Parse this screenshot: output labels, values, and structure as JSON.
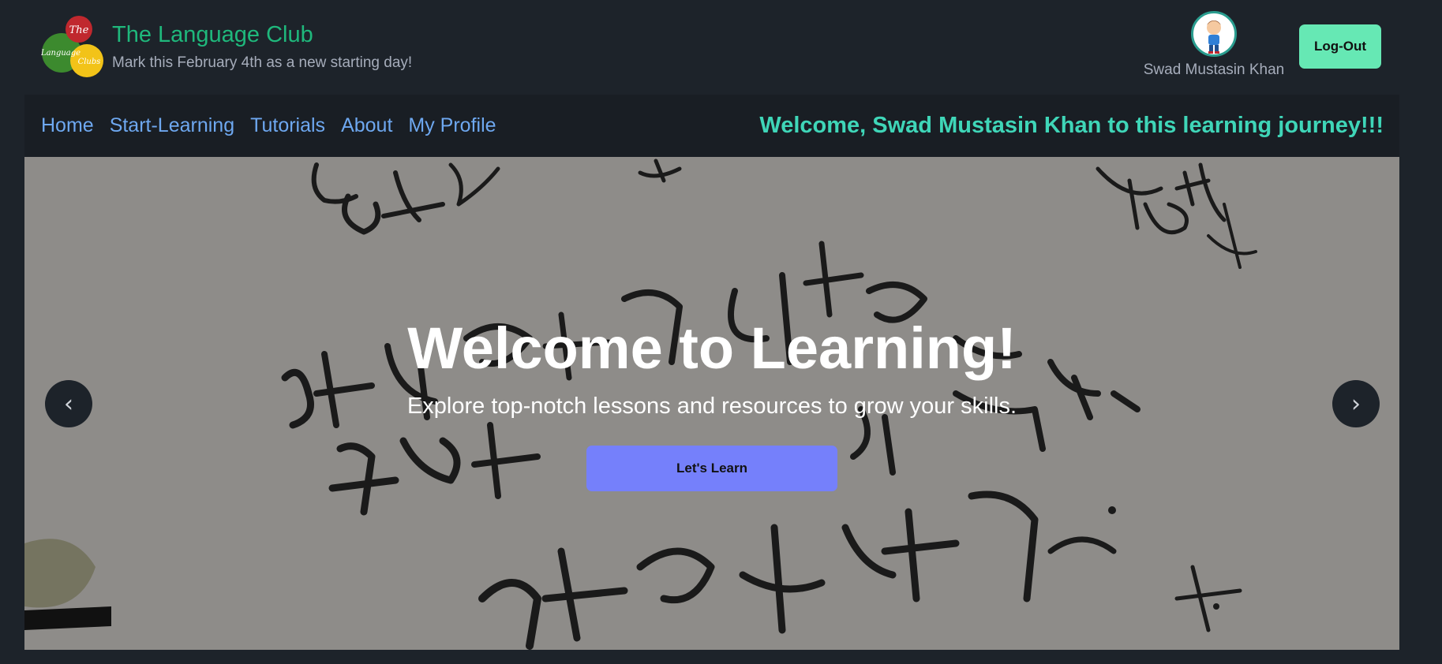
{
  "header": {
    "brand_title": "The Language Club",
    "brand_subtitle": "Mark this February 4th as a new starting day!",
    "logo": {
      "word_top": "The",
      "word_middle": "Language",
      "word_right": "Clubs",
      "colors": [
        "#c0282e",
        "#3c8a2e",
        "#f2c318"
      ]
    },
    "user_name": "Swad Mustasin Khan",
    "logout_label": "Log-Out"
  },
  "nav": {
    "items": [
      {
        "label": "Home"
      },
      {
        "label": "Start-Learning"
      },
      {
        "label": "Tutorials"
      },
      {
        "label": "About"
      },
      {
        "label": "My Profile"
      }
    ],
    "welcome_message": "Welcome, Swad Mustasin Khan to this learning journey!!!"
  },
  "hero": {
    "title": "Welcome to Learning!",
    "subtitle": "Explore top-notch lessons and resources to grow your skills.",
    "cta_label": "Let's Learn",
    "prev_icon": "‹",
    "next_icon": "›"
  },
  "colors": {
    "page_bg": "#1d232a",
    "brand": "#1fb87c",
    "nav_link": "#6ea8f0",
    "welcome": "#3fd6b8",
    "logout_bg": "#66e8b4",
    "cta_bg": "#7580fb"
  }
}
